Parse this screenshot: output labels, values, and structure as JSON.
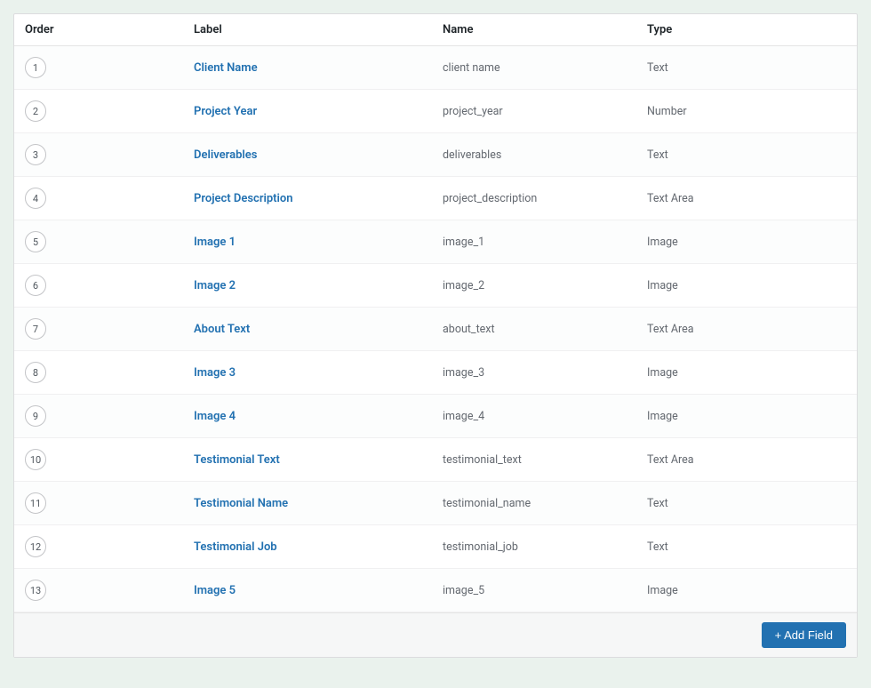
{
  "columns": {
    "order": "Order",
    "label": "Label",
    "name": "Name",
    "type": "Type"
  },
  "fields": [
    {
      "order": "1",
      "label": "Client Name",
      "name": "client name",
      "type": "Text"
    },
    {
      "order": "2",
      "label": "Project Year",
      "name": "project_year",
      "type": "Number"
    },
    {
      "order": "3",
      "label": "Deliverables",
      "name": "deliverables",
      "type": "Text"
    },
    {
      "order": "4",
      "label": "Project Description",
      "name": "project_description",
      "type": "Text Area"
    },
    {
      "order": "5",
      "label": "Image 1",
      "name": "image_1",
      "type": "Image"
    },
    {
      "order": "6",
      "label": "Image 2",
      "name": "image_2",
      "type": "Image"
    },
    {
      "order": "7",
      "label": "About Text",
      "name": "about_text",
      "type": "Text Area"
    },
    {
      "order": "8",
      "label": "Image 3",
      "name": "image_3",
      "type": "Image"
    },
    {
      "order": "9",
      "label": "Image 4",
      "name": "image_4",
      "type": "Image"
    },
    {
      "order": "10",
      "label": "Testimonial Text",
      "name": "testimonial_text",
      "type": "Text Area"
    },
    {
      "order": "11",
      "label": "Testimonial Name",
      "name": "testimonial_name",
      "type": "Text"
    },
    {
      "order": "12",
      "label": "Testimonial Job",
      "name": "testimonial_job",
      "type": "Text"
    },
    {
      "order": "13",
      "label": "Image 5",
      "name": "image_5",
      "type": "Image"
    }
  ],
  "buttons": {
    "add_field": "+ Add Field"
  }
}
